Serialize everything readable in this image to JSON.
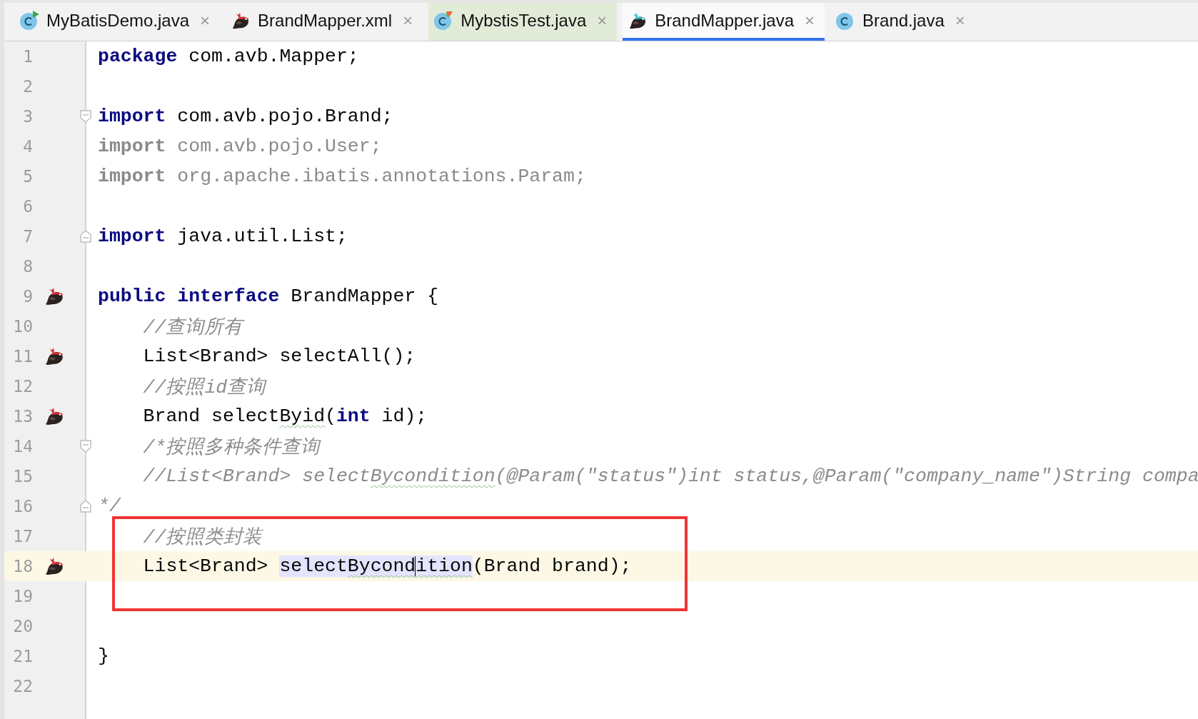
{
  "tabs": [
    {
      "label": "MyBatisDemo.java",
      "kind": "classrun",
      "close": "×",
      "test_scope": false,
      "selected": false
    },
    {
      "label": "BrandMapper.xml",
      "kind": "mybatis",
      "close": "×",
      "test_scope": false,
      "selected": false
    },
    {
      "label": "MybstisTest.java",
      "kind": "classtest",
      "close": "×",
      "test_scope": true,
      "selected": false
    },
    {
      "label": "BrandMapper.java",
      "kind": "mybatisactive",
      "close": "×",
      "test_scope": false,
      "selected": true
    },
    {
      "label": "Brand.java",
      "kind": "class",
      "close": "×",
      "test_scope": false,
      "selected": false
    }
  ],
  "editor": {
    "lines": [
      {
        "number": "1",
        "indented": false,
        "fold_open": false,
        "fold_close": false,
        "mapper_icon": false,
        "current": false,
        "boxed": false,
        "tokens": [
          {
            "kind": "keyword",
            "text": "package"
          },
          {
            "kind": "plain",
            "text": " com.avb.Mapper;"
          }
        ]
      },
      {
        "number": "2",
        "fold_open": false,
        "fold_close": false,
        "mapper_icon": false,
        "current": false,
        "boxed": false
      },
      {
        "number": "3",
        "indented": false,
        "fold_open": true,
        "fold_close": false,
        "mapper_icon": false,
        "current": false,
        "boxed": false,
        "tokens": [
          {
            "kind": "keyword",
            "text": "import"
          },
          {
            "kind": "plain",
            "text": " com.avb.pojo.Brand;"
          }
        ]
      },
      {
        "number": "4",
        "indented": false,
        "fold_open": false,
        "fold_close": false,
        "mapper_icon": false,
        "current": false,
        "boxed": false,
        "tokens": [
          {
            "kind": "unusedkeyword",
            "text": "import"
          },
          {
            "kind": "unused",
            "text": " com.avb.pojo.User;"
          }
        ]
      },
      {
        "number": "5",
        "indented": false,
        "fold_open": false,
        "fold_close": false,
        "mapper_icon": false,
        "current": false,
        "boxed": false,
        "tokens": [
          {
            "kind": "unusedkeyword",
            "text": "import"
          },
          {
            "kind": "unused",
            "text": " org.apache.ibatis.annotations.Param;"
          }
        ]
      },
      {
        "number": "6",
        "fold_open": false,
        "fold_close": false,
        "mapper_icon": false,
        "current": false,
        "boxed": false
      },
      {
        "number": "7",
        "indented": false,
        "fold_open": false,
        "fold_close": true,
        "mapper_icon": false,
        "current": false,
        "boxed": false,
        "tokens": [
          {
            "kind": "keyword",
            "text": "import"
          },
          {
            "kind": "plain",
            "text": " java.util.List;"
          }
        ]
      },
      {
        "number": "8",
        "fold_open": false,
        "fold_close": false,
        "mapper_icon": false,
        "current": false,
        "boxed": false
      },
      {
        "number": "9",
        "indented": false,
        "fold_open": false,
        "fold_close": false,
        "mapper_icon": true,
        "current": false,
        "boxed": false,
        "tokens": [
          {
            "kind": "keyword",
            "text": "public interface"
          },
          {
            "kind": "plain",
            "text": " BrandMapper {"
          }
        ]
      },
      {
        "number": "10",
        "indented": true,
        "fold_open": false,
        "fold_close": false,
        "mapper_icon": false,
        "current": false,
        "boxed": false,
        "tokens": [
          {
            "kind": "comment",
            "text": "//查询所有"
          }
        ]
      },
      {
        "number": "11",
        "indented": true,
        "fold_open": false,
        "fold_close": false,
        "mapper_icon": true,
        "current": false,
        "boxed": false,
        "tokens": [
          {
            "kind": "plain",
            "text": "List<Brand> selectAll();"
          }
        ]
      },
      {
        "number": "12",
        "indented": true,
        "fold_open": false,
        "fold_close": false,
        "mapper_icon": false,
        "current": false,
        "boxed": false,
        "tokens": [
          {
            "kind": "comment",
            "text": "//按照id查询"
          }
        ]
      },
      {
        "number": "13",
        "indented": true,
        "fold_open": false,
        "fold_close": false,
        "mapper_icon": true,
        "current": false,
        "boxed": false,
        "tokens": [
          {
            "kind": "plain",
            "text": "Brand select"
          },
          {
            "kind": "typo",
            "text": "Byid"
          },
          {
            "kind": "plain",
            "text": "("
          },
          {
            "kind": "keyword",
            "text": "int"
          },
          {
            "kind": "plain",
            "text": " id);"
          }
        ]
      },
      {
        "number": "14",
        "indented": true,
        "fold_open": true,
        "fold_close": false,
        "mapper_icon": false,
        "current": false,
        "boxed": false,
        "tokens": [
          {
            "kind": "comment",
            "text": "/*按照多种条件查询"
          }
        ]
      },
      {
        "number": "15",
        "indented": true,
        "fold_open": false,
        "fold_close": false,
        "mapper_icon": false,
        "current": false,
        "boxed": false,
        "tokens": [
          {
            "kind": "comment",
            "text": "//List<Brand> select"
          },
          {
            "kind": "commenttypo",
            "text": "Bycondition"
          },
          {
            "kind": "comment",
            "text": "(@Param(\"status\")int status,@Param(\"company_name\")String compa"
          }
        ]
      },
      {
        "number": "16",
        "indented": false,
        "fold_open": false,
        "fold_close": true,
        "mapper_icon": false,
        "current": false,
        "boxed": false,
        "tokens": [
          {
            "kind": "comment",
            "text": "*/"
          }
        ]
      },
      {
        "number": "17",
        "indented": true,
        "fold_open": false,
        "fold_close": false,
        "mapper_icon": false,
        "current": false,
        "boxed": true,
        "tokens": [
          {
            "kind": "comment",
            "text": "//按照类封装"
          }
        ]
      },
      {
        "number": "18",
        "indented": true,
        "fold_open": false,
        "fold_close": false,
        "mapper_icon": true,
        "current": true,
        "boxed": true,
        "tokens": [
          {
            "kind": "plain",
            "text": "List<Brand> "
          },
          {
            "kind": "match",
            "text": "select"
          },
          {
            "kind": "matchtypo",
            "text": "Bycond"
          },
          {
            "kind": "caret"
          },
          {
            "kind": "matchtypo",
            "text": "ition"
          },
          {
            "kind": "plain",
            "text": "(Brand brand);"
          }
        ]
      },
      {
        "number": "19",
        "fold_open": false,
        "fold_close": false,
        "mapper_icon": false,
        "current": false,
        "boxed": true
      },
      {
        "number": "20",
        "fold_open": false,
        "fold_close": false,
        "mapper_icon": false,
        "current": false,
        "boxed": false
      },
      {
        "number": "21",
        "indented": false,
        "fold_open": false,
        "fold_close": false,
        "mapper_icon": false,
        "current": false,
        "boxed": false,
        "tokens": [
          {
            "kind": "plain",
            "text": "}"
          }
        ]
      },
      {
        "number": "22",
        "fold_open": false,
        "fold_close": false,
        "mapper_icon": false,
        "current": false,
        "boxed": false
      }
    ]
  }
}
